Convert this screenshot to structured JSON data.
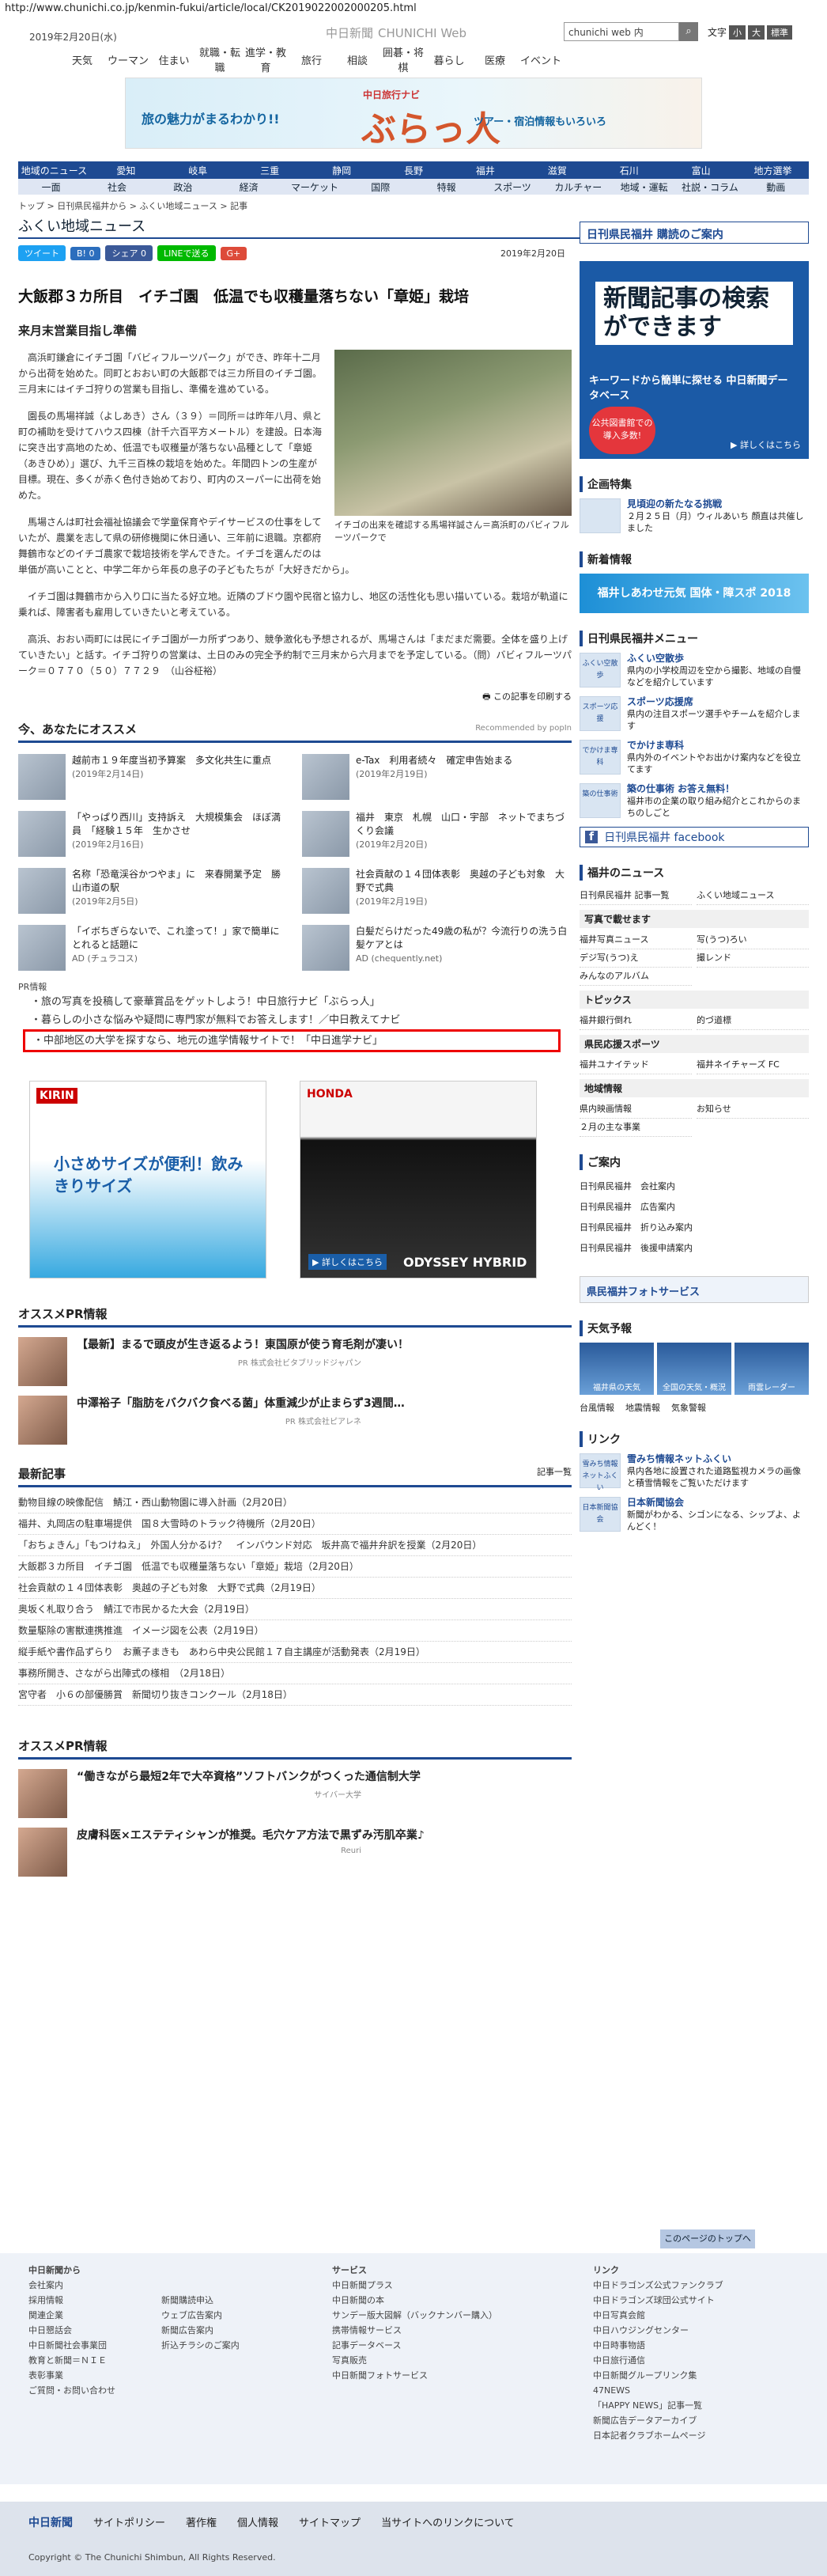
{
  "url": "http://www.chunichi.co.jp/kenmin-fukui/article/local/CK2019022002000205.html",
  "header": {
    "date": "2019年2月20日(水)",
    "logo": "中日新聞",
    "logo_en": "CHUNICHI Web",
    "search_value": "chunichi web 内",
    "search_icon": "search-icon",
    "font_label": "文字",
    "font_small": "小",
    "font_large": "大",
    "font_reset": "標準"
  },
  "topnav": [
    "天気",
    "ウーマン",
    "住まい",
    "就職・転職",
    "進学・教育",
    "旅行",
    "相談",
    "囲碁・将棋",
    "暮らし",
    "医療",
    "イベント"
  ],
  "banner": {
    "lead": "旅の魅力がまるわかり!!",
    "brand": "中日旅行ナビ",
    "title": "ぶらっ人",
    "sub": "ツアー・宿泊情報もいろいろ"
  },
  "nav1": [
    "地域のニュース",
    "愛知",
    "岐阜",
    "三重",
    "静岡",
    "長野",
    "福井",
    "滋賀",
    "石川",
    "富山",
    "地方選挙"
  ],
  "nav2": [
    "一面",
    "社会",
    "政治",
    "経済",
    "マーケット",
    "国際",
    "特報",
    "スポーツ",
    "カルチャー",
    "地域・運転",
    "社説・コラム",
    "動画"
  ],
  "breadcrumb": "トップ > 日刊県民福井から > ふくい地域ニュース > 記事",
  "section_title": "ふくい地域ニュース",
  "social": [
    "ツイート",
    "B! 0",
    "シェア 0",
    "LINEで送る",
    "G+"
  ],
  "pub_date": "2019年2月20日",
  "headline": "大飯郡３カ所目　イチゴ園　低温でも収穫量落ちない「章姫」栽培",
  "subhead": "来月末営業目指し準備",
  "photo_caption": "イチゴの出来を確認する馬場祥誠さん＝高浜町のバビィフルーツパークで",
  "paragraphs": [
    "高浜町鎌倉にイチゴ園「バビィフルーツパーク」ができ、昨年十二月から出荷を始めた。同町とおおい町の大飯郡では三カ所目のイチゴ園。三月末にはイチゴ狩りの営業も目指し、準備を進めている。",
    "園長の馬場祥誠（よしあき）さん（３９）＝同所＝は昨年八月、県と町の補助を受けてハウス四棟（計千六百平方メートル）を建設。日本海に突き出す高地のため、低温でも収穫量が落ちない品種として「章姫（あきひめ）」選び、九千三百株の栽培を始めた。年間四トンの生産が目標。現在、多くが赤く色付き始めており、町内のスーパーに出荷を始めた。",
    "馬場さんは町社会福祉協議会で学童保育やデイサービスの仕事をしていたが、農業を志して県の研修機関に休日通い、三年前に退職。京都府舞鶴市などのイチゴ農家で栽培技術を学んできた。イチゴを選んだのは単価が高いことと、中学二年から年長の息子の子どもたちが「大好きだから」。",
    "イチゴ園は舞鶴市から入り口に当たる好立地。近隣のブドウ園や民宿と協力し、地区の活性化も思い描いている。栽培が軌道に乗れば、障害者も雇用していきたいと考えている。",
    "高浜、おおい両町には民にイチゴ園が一カ所ずつあり、競争激化も予想されるが、馬場さんは「まだまだ需要。全体を盛り上げていきたい」と話す。イチゴ狩りの営業は、土日のみの完全予約制で三月末から六月までを予定している。（問）バビィフルーツパーク＝０７７０（５０）７７２９　（山谷柾裕）"
  ],
  "print_label": "この記事を印刷する",
  "recommend": {
    "title": "今、あなたにオススメ",
    "by": "Recommended by popIn",
    "items": [
      {
        "t": "越前市１９年度当初予算案　多文化共生に重点",
        "d": "(2019年2月14日)"
      },
      {
        "t": "e-Tax　利用者続々　確定申告始まる",
        "d": "(2019年2月19日)"
      },
      {
        "t": "「やっぱり西川」支持訴え　大規模集会　ほぼ満員　「経験１５年　生かさせ",
        "d": "(2019年2月16日)"
      },
      {
        "t": "福井　東京　札幌　山口・宇部　ネットでまちづくり会議",
        "d": "(2019年2月20日)"
      },
      {
        "t": "名称「恐竜渓谷かつやま」に　来春開業予定　勝山市道の駅",
        "d": "(2019年2月5日)"
      },
      {
        "t": "社会貢献の１４団体表彰　奥越の子ども対象　大野で式典",
        "d": "(2019年2月19日)"
      },
      {
        "t": "「イボちぎらないで、これ塗って！」家で簡単にとれると話題に",
        "d": "AD (チュラコス)"
      },
      {
        "t": "白髪だらけだった49歳の私が？今流行りの洗う白髪ケアとは",
        "d": "AD (chequently.net)"
      }
    ]
  },
  "pr": {
    "label": "PR情報",
    "items": [
      "旅の写真を投稿して豪華賞品をゲットしよう！中日旅行ナビ「ぶらっ人」",
      "暮らしの小さな悩みや疑問に専門家が無料でお答えします！／中日教えてナビ",
      "中部地区の大学を探すなら、地元の進学情報サイトで！「中日進学ナビ」"
    ]
  },
  "ads": {
    "kirin_logo": "KIRIN",
    "kirin_copy": "小さめサイズが便利！飲みきりサイズ",
    "honda_logo": "HONDA",
    "honda_more": "▶ 詳しくはこちら",
    "honda_copy": "ODYSSEY HYBRID"
  },
  "osusume_pr": {
    "title": "オススメPR情報",
    "items": [
      {
        "t": "【最新】まるで頭皮が生き返るよう！東国原が使う育毛剤が凄い！",
        "s": "PR 株式会社ビタブリッドジャパン"
      },
      {
        "t": "中澤裕子「脂肪をバクバク食べる菌」体重減少が止まらず3週間…",
        "s": "PR 株式会社ピアレネ"
      }
    ]
  },
  "latest": {
    "title": "最新記事",
    "more": "記事一覧",
    "items": [
      "動物目線の映像配信　鯖江・西山動物園に導入計画（2月20日）",
      "福井、丸岡店の駐車場提供　国８大雪時のトラック待機所（2月20日）",
      "「おちょきん」「もつけねえ」　外国人分かるけ？　インバウンド対応　坂井高で福井弁訳を授業（2月20日）",
      "大飯郡３カ所目　イチゴ園　低温でも収穫量落ちない「章姫」栽培（2月20日）",
      "社会貢献の１４団体表彰　奥越の子ども対象　大野で式典（2月19日）",
      "奥坂く札取り合う　鯖江で市民かるた大会（2月19日）",
      "数量駆除の害獣連携推進　イメージ図を公表（2月19日）",
      "縦手紙や書作品ずらり　お薫子まきも　あわら中央公民館１７自主講座が活動発表（2月19日）",
      "事務所開き、さながら出陣式の様相　（2月18日）",
      "宮守者　小６の部優勝賞　新聞切り抜きコンクール（2月18日）"
    ]
  },
  "osusume_pr2": {
    "title": "オススメPR情報",
    "items": [
      {
        "t": "“働きながら最短2年で大卒資格”ソフトバンクがつくった通信制大学",
        "s": "サイバー大学"
      },
      {
        "t": "皮膚科医×エステティシャンが推奨。毛穴ケア方法で黒ずみ汚肌卒業♪",
        "s": "Reuri"
      }
    ]
  },
  "side": {
    "top_link": "日刊県民福井 購読のご案内",
    "ad_title": "新聞記事の検索ができます",
    "ad_sub": "キーワードから簡単に探せる 中日新聞データベース",
    "ad_badge": "公共図書館での導入多数!",
    "ad_more": "▶ 詳しくはこちら",
    "kikaku_title": "企画特集",
    "kikaku_item": "見頃迎の新たなる挑戦",
    "kikaku_desc": "２月２５日（月）ウィルあいち 顔直は共催しました",
    "shinsho_title": "新着情報",
    "shinsho_banner": "福井しあわせ元気 国体・障スポ 2018",
    "menu_title": "日刊県民福井メニュー",
    "menu": [
      {
        "ic": "ふくい空散歩",
        "b": "ふくい空散歩",
        "d": "県内の小学校周辺を空から撮影、地域の自慢などを紹介しています"
      },
      {
        "ic": "スポーツ応援",
        "b": "スポーツ応援席",
        "d": "県内の注目スポーツ選手やチームを紹介します"
      },
      {
        "ic": "でかけま専科",
        "b": "でかけま専科",
        "d": "県内外のイベントやお出かけ案内などを役立てます"
      },
      {
        "ic": "築の仕事術",
        "b": "築の仕事術 お答え無料！",
        "d": "福井市の企業の取り組み紹介とこれからのまちのしごと"
      }
    ],
    "facebook": "日刊県民福井 facebook",
    "fnews_title": "福井のニュース",
    "fnews": [
      "日刊県民福井 記事一覧",
      "ふくい地域ニュース"
    ],
    "photo_title": "写真で載せます",
    "photos": [
      "福井写真ニュース",
      "写(うつ)ろい",
      "デジ写(うつ)え",
      "撮レンド",
      "みんなのアルバム"
    ],
    "topics_title": "トピックス",
    "topics": [
      "福井銀行倒れ",
      "的づ道標"
    ],
    "sports_title": "県民応援スポーツ",
    "sports": [
      "福井ユナイテッド",
      "福井ネイチャーズ FC"
    ],
    "chiiki_title": "地域情報",
    "chiiki": [
      "県内映画情報",
      "お知らせ",
      "２月の主な事業"
    ],
    "annai_title": "ご案内",
    "annai": [
      "日刊県民福井　会社案内",
      "日刊県民福井　広告案内",
      "日刊県民福井　折り込み案内",
      "日刊県民福井　後援申請案内"
    ],
    "photo_service": "県民福井フォトサービス",
    "weather_title": "天気予報",
    "weather": [
      "福井県の天気",
      "全国の天気・概況",
      "雨雲レーダー"
    ],
    "weather_links": [
      "台風情報",
      "地震情報",
      "気象警報"
    ],
    "link_title": "リンク",
    "links": [
      {
        "ic": "雪みち情報ネットふくい",
        "b": "雪みち情報ネットふくい",
        "d": "県内各地に設置された道路監視カメラの画像と積雪情報をご覧いただけます"
      },
      {
        "ic": "日本新聞協会",
        "b": "日本新聞協会",
        "d": "新聞がわかる、シゴンになる、シップよ、よんどく！"
      }
    ]
  },
  "top_button": "このページのトップへ",
  "footer": {
    "col1": [
      "中日新聞から",
      "会社案内",
      "採用情報",
      "関連企業",
      "中日懇話会",
      "中日新聞社会事業団",
      "教育と新聞＝ＮＩＥ",
      "表彰事業",
      "ご質問・お問い合わせ"
    ],
    "col2": [
      "新聞購読申込",
      "ウェブ広告案内",
      "新聞広告案内",
      "折込チラシのご案内"
    ],
    "col3": [
      "サービス",
      "中日新聞プラス",
      "中日新聞の本",
      "サンデー版大図解（バックナンバー購入）",
      "携帯情報サービス",
      "記事データベース",
      "写真販売",
      "中日新聞フォトサービス"
    ],
    "col4": [
      "リンク",
      "中日ドラゴンズ公式ファンクラブ",
      "中日ドラゴンズ球団公式サイト",
      "中日写真会館",
      "中日ハウジングセンター",
      "中日時事物語",
      "中日旅行通信",
      "中日新聞グループリンク集",
      "47NEWS",
      "「HAPPY NEWS」記事一覧",
      "新聞広告データアーカイブ",
      "日本記者クラブホームページ"
    ],
    "bottom": [
      "中日新聞",
      "サイトポリシー",
      "著作権",
      "個人情報",
      "サイトマップ",
      "当サイトへのリンクについて"
    ],
    "copyright": "Copyright © The Chunichi Shimbun, All Rights Reserved."
  }
}
